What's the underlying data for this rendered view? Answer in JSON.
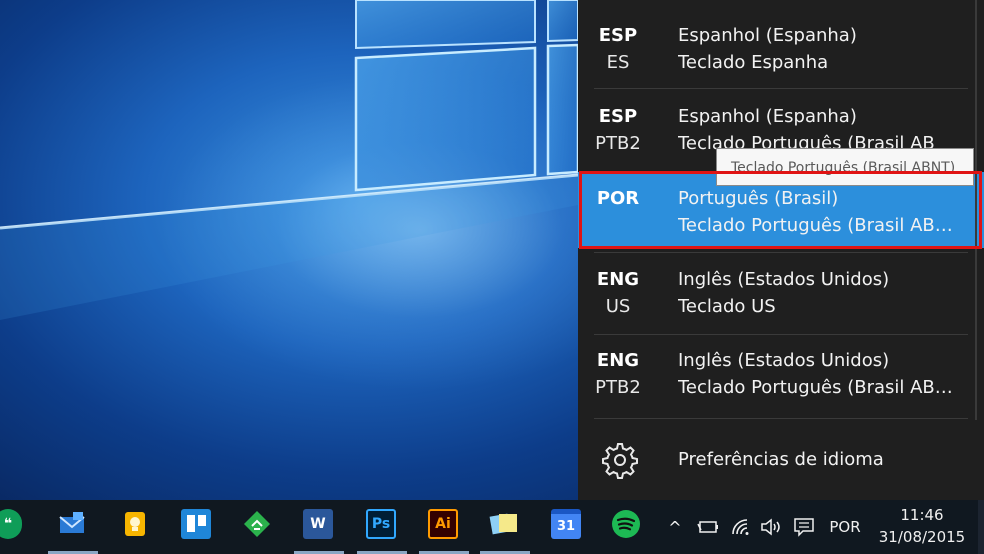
{
  "language_flyout": {
    "items": [
      {
        "code": "ESP",
        "sub_code": "ES",
        "language": "Espanhol (Espanha)",
        "keyboard": "Teclado Espanha",
        "selected": false
      },
      {
        "code": "ESP",
        "sub_code": "PTB2",
        "language": "Espanhol (Espanha)",
        "keyboard": "Teclado Português (Brasil AB",
        "selected": false
      },
      {
        "code": "POR",
        "sub_code": "",
        "language": "Português (Brasil)",
        "keyboard": "Teclado Português (Brasil AB…",
        "selected": true
      },
      {
        "code": "ENG",
        "sub_code": "US",
        "language": "Inglês (Estados Unidos)",
        "keyboard": "Teclado US",
        "selected": false
      },
      {
        "code": "ENG",
        "sub_code": "PTB2",
        "language": "Inglês (Estados Unidos)",
        "keyboard": "Teclado Português (Brasil AB…",
        "selected": false
      }
    ],
    "tooltip": "Teclado Português (Brasil ABNT)",
    "preferences_label": "Preferências de idioma",
    "preferences_icon": "gear-icon",
    "selected_color": "#2c8fdc",
    "highlight_color": "#e01414"
  },
  "taskbar": {
    "apps": [
      {
        "name": "hangouts",
        "icon": "chat-bubble-icon",
        "color": "#0f9d58"
      },
      {
        "name": "mail",
        "icon": "mail-icon",
        "color": "#2a7ad5",
        "running": true
      },
      {
        "name": "keep",
        "icon": "lightbulb-icon",
        "color": "#f7b500"
      },
      {
        "name": "trello",
        "icon": "board-icon",
        "color": "#1f86d8"
      },
      {
        "name": "feedly",
        "icon": "feed-icon",
        "color": "#2bb24c"
      },
      {
        "name": "word",
        "icon": "word-icon",
        "label": "W",
        "color": "#2b579a",
        "running": true
      },
      {
        "name": "photoshop",
        "icon": "photoshop-icon",
        "label": "Ps",
        "color": "#001e36",
        "running": true
      },
      {
        "name": "illustrator",
        "icon": "illustrator-icon",
        "label": "Ai",
        "color": "#330000",
        "running": true
      },
      {
        "name": "sticky-notes",
        "icon": "notes-icon",
        "color": "#f5e98a",
        "running": true
      },
      {
        "name": "calendar",
        "icon": "calendar-icon",
        "label": "31",
        "color": "#4285f4"
      },
      {
        "name": "spotify",
        "icon": "spotify-icon",
        "color": "#1db954"
      }
    ],
    "tray": {
      "language": "POR",
      "time": "11:46",
      "date": "31/08/2015"
    }
  }
}
